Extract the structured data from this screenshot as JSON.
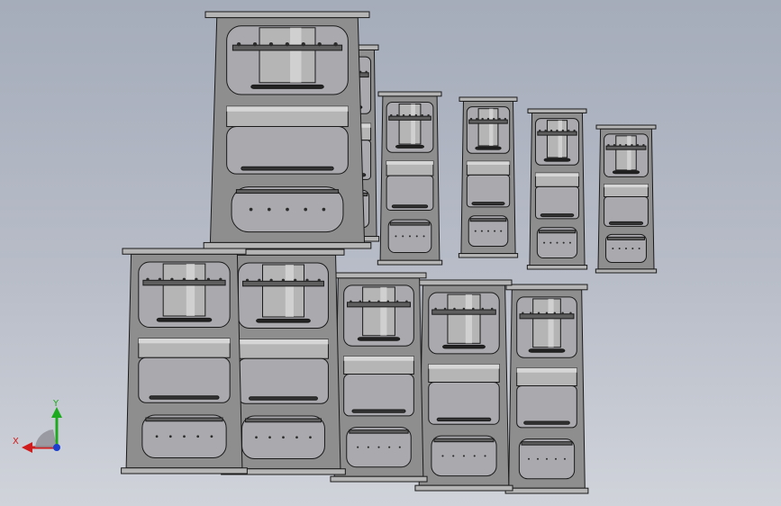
{
  "viewport": {
    "background_top": "#a5acba",
    "background_bottom": "#d0d3da",
    "part_color": "#8e8e8e",
    "part_light": "#b5b5b5",
    "part_dark": "#5e5e5e",
    "edge_color": "#1a1a1a"
  },
  "models": [
    {
      "id": "press-frame-1"
    },
    {
      "id": "press-frame-2"
    },
    {
      "id": "press-frame-3"
    },
    {
      "id": "press-frame-4"
    },
    {
      "id": "press-frame-5"
    },
    {
      "id": "press-frame-6"
    },
    {
      "id": "press-frame-7"
    },
    {
      "id": "press-frame-8"
    },
    {
      "id": "press-frame-9"
    },
    {
      "id": "press-frame-10"
    },
    {
      "id": "press-frame-11"
    },
    {
      "id": "press-frame-12"
    }
  ],
  "triad": {
    "x_label": "X",
    "y_label": "Y",
    "x_color": "#d01c1c",
    "y_color": "#1eaa1e",
    "z_color": "#1c3fd0"
  }
}
